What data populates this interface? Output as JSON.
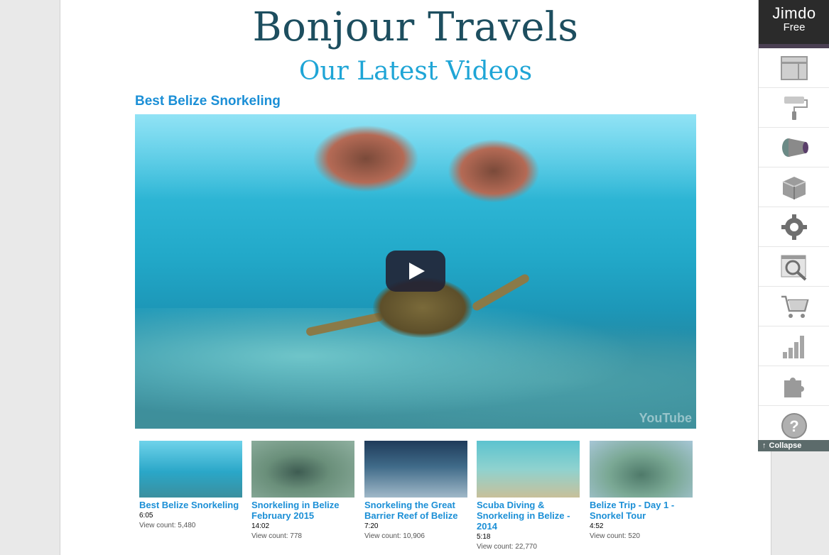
{
  "site": {
    "title": "Bonjour Travels",
    "subtitle": "Our Latest Videos"
  },
  "featured": {
    "title": "Best Belize Snorkeling",
    "watermark": "YouTube"
  },
  "videos": [
    {
      "title": "Best Belize Snorkeling",
      "duration": "6:05",
      "views": "View count: 5,480"
    },
    {
      "title": "Snorkeling in Belize February 2015",
      "duration": "14:02",
      "views": "View count: 778"
    },
    {
      "title": "Snorkeling the Great Barrier Reef of Belize",
      "duration": "7:20",
      "views": "View count: 10,906"
    },
    {
      "title": "Scuba Diving & Snorkeling in Belize - 2014",
      "duration": "5:18",
      "views": "View count: 22,770"
    },
    {
      "title": "Belize Trip - Day 1 - Snorkel Tour",
      "duration": "4:52",
      "views": "View count: 520"
    }
  ],
  "jimdo": {
    "logo": "Jimdo",
    "plan": "Free",
    "collapse": "Collapse",
    "icons": [
      "layout-icon",
      "paint-roller-icon",
      "megaphone-icon",
      "box-icon",
      "gear-icon",
      "seo-magnifier-icon",
      "shopping-cart-icon",
      "statistics-icon",
      "puzzle-icon",
      "help-icon"
    ]
  },
  "colors": {
    "title": "#1d4e5f",
    "subtitle": "#1fa5d6",
    "link": "#1b8fd6",
    "sidebar_dark": "#2b2b2b"
  }
}
